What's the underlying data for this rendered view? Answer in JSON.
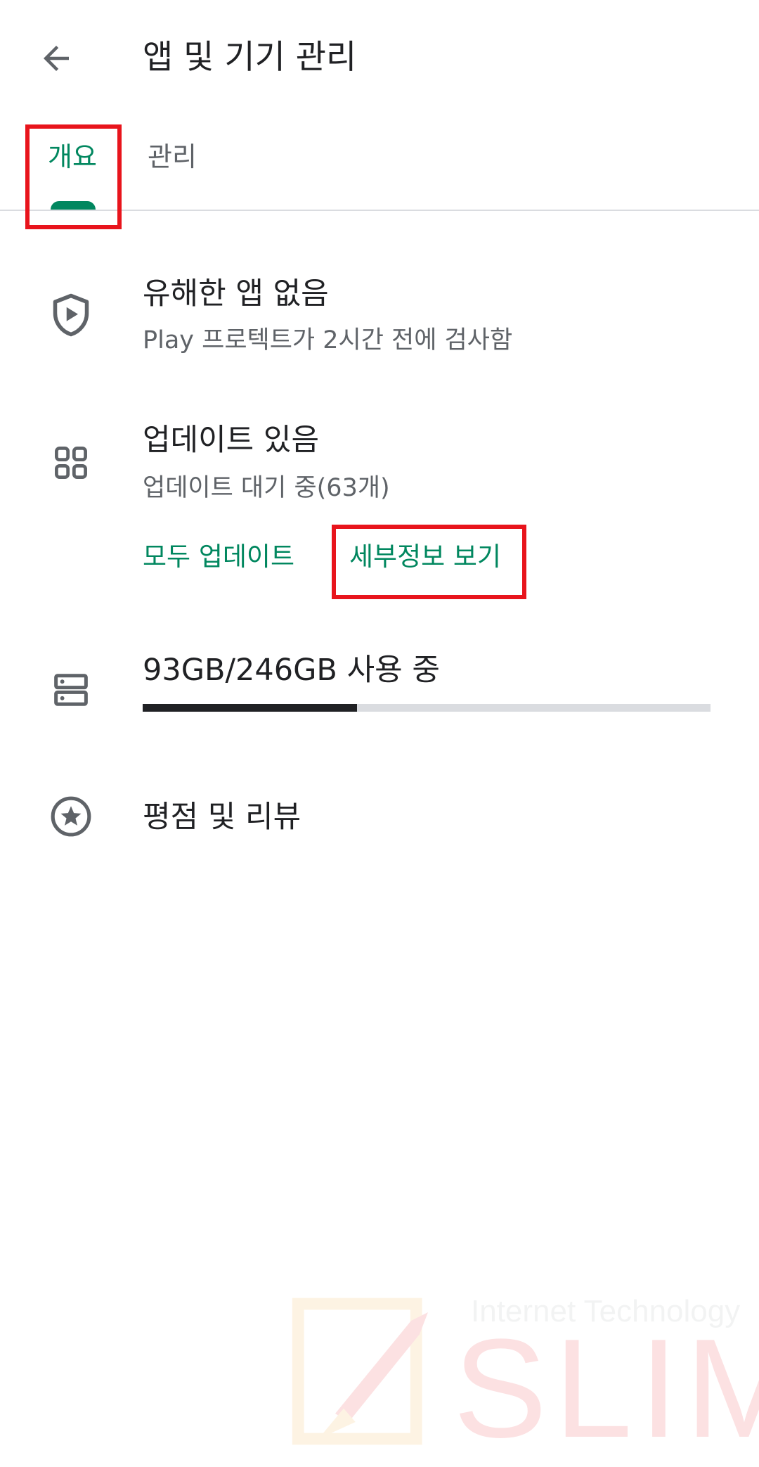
{
  "header": {
    "title": "앱 및 기기 관리",
    "back_icon": "arrow-back-icon"
  },
  "tabs": [
    {
      "label": "개요",
      "selected": true
    },
    {
      "label": "관리",
      "selected": false
    }
  ],
  "protection": {
    "icon": "shield-play-icon",
    "title": "유해한 앱 없음",
    "subtitle": "Play 프로텍트가 2시간 전에 검사함"
  },
  "updates": {
    "icon": "apps-grid-icon",
    "title": "업데이트 있음",
    "subtitle": "업데이트 대기 중(63개)",
    "update_all_label": "모두 업데이트",
    "see_details_label": "세부정보 보기"
  },
  "storage": {
    "icon": "storage-icon",
    "title": "93GB/246GB 사용 중",
    "used_fraction": 0.378
  },
  "ratings": {
    "icon": "star-circle-icon",
    "title": "평점 및 리뷰"
  },
  "watermark": {
    "subtitle": "Internet Technology",
    "brand": "SLIM"
  },
  "colors": {
    "accent": "#01875f",
    "annotation": "#e8141c",
    "text_primary": "#202124",
    "text_secondary": "#5f6368"
  }
}
